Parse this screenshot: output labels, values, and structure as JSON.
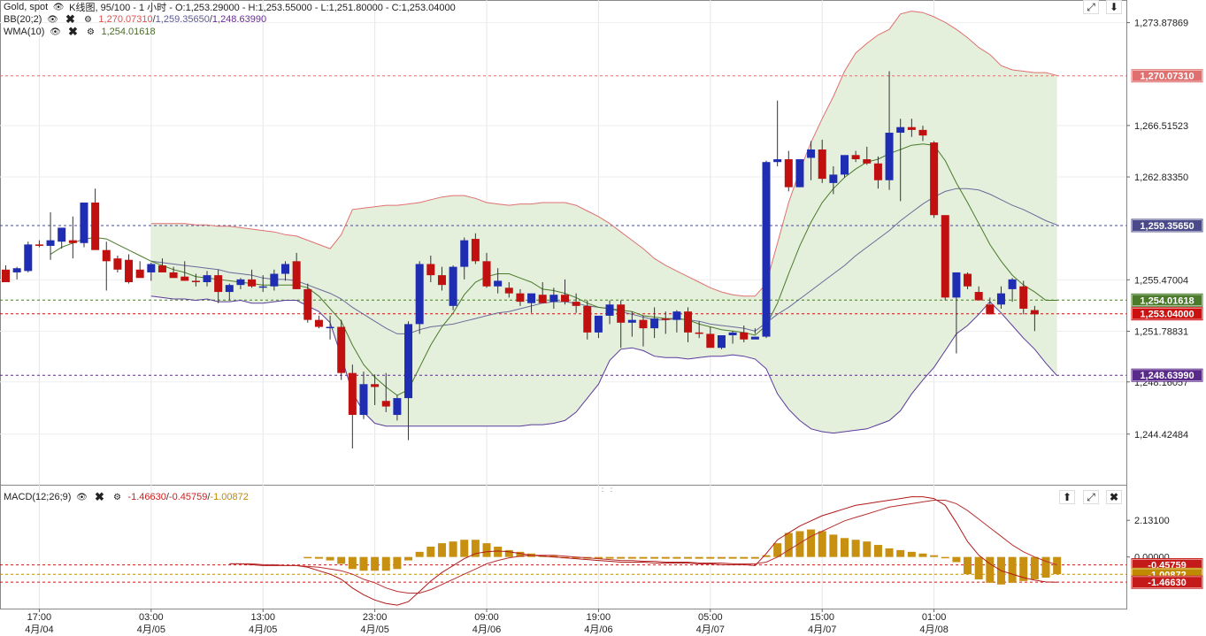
{
  "header": {
    "symbol": "Gold, spot",
    "chart_info": "K线图, 95/100 - 1 小时 - O:1,253.29000 - H:1,253.55000 - L:1,251.80000 - C:1,253.04000",
    "bb_label": "BB(20;2)",
    "bb_upper": "1,270.07310",
    "bb_mid": "1,259.35650",
    "bb_lower": "1,248.63990",
    "wma_label": "WMA(10)",
    "wma_value": "1,254.01618",
    "macd_label": "MACD(12;26;9)",
    "macd_v1": "-1.46630",
    "macd_v2": "-0.45759",
    "macd_v3": "-1.00872"
  },
  "colors": {
    "bull": "#1f2db3",
    "bear": "#c01010",
    "band_fill": "#e4f0dc",
    "bb_upper": "#e07070",
    "bb_mid": "#6a6a9a",
    "bb_lower": "#5a3a9a",
    "wma": "#4a7a2a",
    "macd_hist": "#c89010",
    "macd_line": "#b01818",
    "signal_line": "#b83030"
  },
  "icons": [
    "eye-icon",
    "close-icon",
    "gear-icon",
    "expand-icon",
    "arrow-up-icon",
    "arrow-down-icon"
  ],
  "chart_data": {
    "type": "candlestick",
    "ylim": [
      1240.8,
      1275.5
    ],
    "x_ticks": [
      {
        "time": "17:00",
        "date": "4月/04",
        "index": 3
      },
      {
        "time": "03:00",
        "date": "4月/05",
        "index": 13
      },
      {
        "time": "13:00",
        "date": "4月/05",
        "index": 23
      },
      {
        "time": "23:00",
        "date": "4月/05",
        "index": 33
      },
      {
        "time": "09:00",
        "date": "4月/06",
        "index": 43
      },
      {
        "time": "19:00",
        "date": "4月/06",
        "index": 53
      },
      {
        "time": "05:00",
        "date": "4月/07",
        "index": 63
      },
      {
        "time": "15:00",
        "date": "4月/07",
        "index": 73
      },
      {
        "time": "01:00",
        "date": "4月/08",
        "index": 83
      }
    ],
    "y_ticks": [
      "1,273.87869",
      "1,266.51523",
      "1,262.83350",
      "1,255.47004",
      "1,251.78831",
      "1,248.16057",
      "1,244.42484"
    ],
    "y_tick_values": [
      1273.87869,
      1266.51523,
      1262.8335,
      1255.47004,
      1251.78831,
      1248.16057,
      1244.42484
    ],
    "price_tags": [
      {
        "label": "1,270.07310",
        "value": 1270.0731,
        "color": "#e07070"
      },
      {
        "label": "1,259.35650",
        "value": 1259.3565,
        "color": "#4a4a8a"
      },
      {
        "label": "1,254.01618",
        "value": 1254.01618,
        "color": "#4a7a2a"
      },
      {
        "label": "1,253.04000",
        "value": 1253.04,
        "color": "#cc1010"
      },
      {
        "label": "1,248.63990",
        "value": 1248.6399,
        "color": "#5a2a8a"
      }
    ],
    "candles": [
      [
        1256.2,
        1256.5,
        1255.3,
        1255.3
      ],
      [
        1256.0,
        1256.4,
        1255.5,
        1256.3
      ],
      [
        1256.1,
        1258.2,
        1256.0,
        1258.0
      ],
      [
        1258.0,
        1258.3,
        1257.8,
        1257.9
      ],
      [
        1257.9,
        1260.3,
        1256.9,
        1258.3
      ],
      [
        1258.2,
        1259.0,
        1257.7,
        1259.2
      ],
      [
        1258.3,
        1260.0,
        1257.0,
        1258.1
      ],
      [
        1258.1,
        1259.9,
        1257.8,
        1261.0
      ],
      [
        1261.0,
        1262.0,
        1258.0,
        1257.6
      ],
      [
        1257.6,
        1258.2,
        1254.7,
        1256.8
      ],
      [
        1257.0,
        1257.2,
        1256.0,
        1256.2
      ],
      [
        1256.9,
        1257.3,
        1255.2,
        1255.3
      ],
      [
        1256.2,
        1256.8,
        1255.7,
        1255.6
      ],
      [
        1256.0,
        1256.7,
        1255.4,
        1256.6
      ],
      [
        1256.5,
        1257.0,
        1256.0,
        1256.0
      ],
      [
        1256.0,
        1256.4,
        1255.8,
        1255.6
      ],
      [
        1255.7,
        1256.8,
        1255.4,
        1255.4
      ],
      [
        1255.4,
        1255.9,
        1255.0,
        1255.3
      ],
      [
        1255.3,
        1256.1,
        1255.0,
        1255.8
      ],
      [
        1255.8,
        1256.2,
        1253.8,
        1254.6
      ],
      [
        1254.6,
        1255.2,
        1254.0,
        1255.1
      ],
      [
        1255.1,
        1255.6,
        1254.8,
        1255.5
      ],
      [
        1255.5,
        1256.2,
        1254.9,
        1255.0
      ],
      [
        1255.0,
        1255.8,
        1254.6,
        1255.0
      ],
      [
        1255.0,
        1256.2,
        1254.7,
        1255.9
      ],
      [
        1255.9,
        1256.8,
        1255.4,
        1256.6
      ],
      [
        1256.8,
        1257.4,
        1254.8,
        1254.8
      ],
      [
        1254.8,
        1255.2,
        1252.4,
        1252.6
      ],
      [
        1252.6,
        1252.9,
        1252.0,
        1252.1
      ],
      [
        1252.1,
        1252.9,
        1251.2,
        1252.1
      ],
      [
        1252.1,
        1252.6,
        1248.3,
        1248.8
      ],
      [
        1248.8,
        1249.4,
        1243.4,
        1245.8
      ],
      [
        1245.8,
        1248.9,
        1245.5,
        1248.0
      ],
      [
        1248.0,
        1248.7,
        1246.5,
        1247.8
      ],
      [
        1246.8,
        1248.8,
        1246.0,
        1246.4
      ],
      [
        1245.8,
        1247.2,
        1245.4,
        1247.0
      ],
      [
        1247.0,
        1252.5,
        1244.0,
        1252.3
      ],
      [
        1252.3,
        1256.8,
        1251.6,
        1256.6
      ],
      [
        1256.6,
        1257.2,
        1255.3,
        1255.8
      ],
      [
        1255.8,
        1256.4,
        1254.7,
        1255.1
      ],
      [
        1253.6,
        1256.5,
        1253.3,
        1256.4
      ],
      [
        1256.4,
        1258.5,
        1255.5,
        1258.3
      ],
      [
        1258.4,
        1258.8,
        1256.6,
        1256.8
      ],
      [
        1256.8,
        1257.4,
        1254.9,
        1255.0
      ],
      [
        1255.0,
        1256.3,
        1254.5,
        1255.4
      ],
      [
        1254.9,
        1255.3,
        1254.2,
        1254.5
      ],
      [
        1254.5,
        1254.8,
        1253.6,
        1253.9
      ],
      [
        1253.8,
        1254.2,
        1253.1,
        1254.5
      ],
      [
        1254.4,
        1255.3,
        1253.8,
        1253.8
      ],
      [
        1253.9,
        1254.9,
        1253.4,
        1254.4
      ],
      [
        1254.4,
        1255.5,
        1253.7,
        1253.9
      ],
      [
        1253.9,
        1254.5,
        1253.1,
        1253.6
      ],
      [
        1253.6,
        1254.0,
        1251.2,
        1251.7
      ],
      [
        1251.7,
        1252.3,
        1251.3,
        1252.9
      ],
      [
        1252.9,
        1254.0,
        1252.3,
        1253.7
      ],
      [
        1253.7,
        1254.0,
        1250.6,
        1252.4
      ],
      [
        1252.4,
        1253.2,
        1251.4,
        1252.6
      ],
      [
        1252.6,
        1252.9,
        1250.7,
        1252.0
      ],
      [
        1252.0,
        1253.5,
        1251.3,
        1252.7
      ],
      [
        1252.7,
        1253.2,
        1251.6,
        1252.6
      ],
      [
        1252.6,
        1253.3,
        1251.7,
        1253.2
      ],
      [
        1253.2,
        1253.5,
        1251.0,
        1251.7
      ],
      [
        1251.7,
        1252.5,
        1251.3,
        1251.6
      ],
      [
        1251.6,
        1252.1,
        1250.9,
        1250.6
      ],
      [
        1250.6,
        1251.3,
        1250.5,
        1251.5
      ],
      [
        1251.5,
        1251.8,
        1250.9,
        1251.7
      ],
      [
        1251.7,
        1252.2,
        1251.0,
        1251.2
      ],
      [
        1251.2,
        1252.0,
        1251.6,
        1251.4
      ],
      [
        1251.4,
        1264.0,
        1251.3,
        1263.9
      ],
      [
        1263.9,
        1268.3,
        1263.6,
        1264.1
      ],
      [
        1264.1,
        1264.7,
        1261.8,
        1262.1
      ],
      [
        1262.1,
        1263.7,
        1262.1,
        1264.1
      ],
      [
        1264.2,
        1265.4,
        1262.6,
        1264.8
      ],
      [
        1264.8,
        1265.5,
        1262.4,
        1262.7
      ],
      [
        1262.4,
        1263.6,
        1261.6,
        1263.0
      ],
      [
        1263.0,
        1264.3,
        1262.8,
        1264.4
      ],
      [
        1264.4,
        1264.7,
        1263.9,
        1264.1
      ],
      [
        1264.1,
        1265.0,
        1263.7,
        1263.8
      ],
      [
        1263.8,
        1264.3,
        1262.0,
        1262.6
      ],
      [
        1262.6,
        1270.4,
        1261.9,
        1266.0
      ],
      [
        1266.0,
        1267.0,
        1261.1,
        1266.4
      ],
      [
        1266.4,
        1267.0,
        1265.7,
        1266.2
      ],
      [
        1266.2,
        1266.5,
        1265.4,
        1265.8
      ],
      [
        1265.3,
        1265.4,
        1259.9,
        1260.1
      ],
      [
        1260.1,
        1260.1,
        1254.0,
        1254.2
      ],
      [
        1254.2,
        1256.0,
        1250.2,
        1256.0
      ],
      [
        1255.9,
        1256.0,
        1254.8,
        1255.0
      ],
      [
        1254.6,
        1255.0,
        1254.0,
        1254.0
      ],
      [
        1253.7,
        1254.2,
        1253.0,
        1253.0
      ],
      [
        1253.7,
        1255.0,
        1253.4,
        1254.5
      ],
      [
        1254.8,
        1255.6,
        1253.9,
        1255.5
      ],
      [
        1255.0,
        1255.4,
        1253.0,
        1253.4
      ],
      [
        1253.3,
        1253.6,
        1251.8,
        1253.0
      ]
    ],
    "bb_upper": [
      null,
      null,
      null,
      null,
      null,
      null,
      null,
      null,
      null,
      null,
      null,
      null,
      null,
      1259.5,
      1259.5,
      1259.5,
      1259.5,
      1259.4,
      1259.4,
      1259.3,
      1259.3,
      1259.2,
      1259.1,
      1259.0,
      1258.9,
      1258.7,
      1258.6,
      1258.3,
      1258.0,
      1257.7,
      1258.7,
      1260.5,
      1260.6,
      1260.7,
      1260.8,
      1260.8,
      1260.9,
      1261.0,
      1261.2,
      1261.4,
      1261.5,
      1261.5,
      1261.3,
      1261.0,
      1260.9,
      1260.8,
      1260.9,
      1260.9,
      1261.0,
      1261.0,
      1261.0,
      1260.8,
      1260.4,
      1260.0,
      1259.5,
      1258.9,
      1258.3,
      1257.7,
      1257.0,
      1256.5,
      1256.1,
      1255.7,
      1255.3,
      1254.9,
      1254.6,
      1254.4,
      1254.3,
      1254.3,
      1255.2,
      1258.1,
      1261.0,
      1263.3,
      1265.3,
      1267.0,
      1268.6,
      1270.4,
      1271.7,
      1272.4,
      1273.0,
      1273.4,
      1274.5,
      1274.7,
      1274.6,
      1274.3,
      1273.9,
      1273.4,
      1272.8,
      1272.1,
      1271.6,
      1270.8,
      1270.5,
      1270.4,
      1270.3,
      1270.3,
      1270.1
    ],
    "bb_mid": [
      null,
      null,
      null,
      null,
      null,
      null,
      null,
      null,
      null,
      null,
      null,
      null,
      null,
      1256.8,
      1256.7,
      1256.6,
      1256.5,
      1256.4,
      1256.3,
      1256.2,
      1256.0,
      1255.9,
      1255.8,
      1255.6,
      1255.5,
      1255.5,
      1255.4,
      1255.1,
      1254.8,
      1254.5,
      1254.1,
      1253.5,
      1253.0,
      1252.5,
      1252.0,
      1251.6,
      1251.6,
      1251.9,
      1252.1,
      1252.2,
      1252.3,
      1252.5,
      1252.7,
      1252.9,
      1253.1,
      1253.2,
      1253.4,
      1253.6,
      1253.8,
      1253.9,
      1253.9,
      1253.8,
      1253.6,
      1253.5,
      1253.4,
      1253.2,
      1253.0,
      1252.8,
      1252.6,
      1252.6,
      1252.7,
      1252.6,
      1252.5,
      1252.3,
      1252.2,
      1252.1,
      1252.0,
      1251.8,
      1252.4,
      1253.0,
      1253.5,
      1254.1,
      1254.7,
      1255.3,
      1255.9,
      1256.5,
      1257.2,
      1257.8,
      1258.4,
      1259.0,
      1259.7,
      1260.3,
      1260.9,
      1261.4,
      1261.8,
      1262.0,
      1262.0,
      1261.9,
      1261.6,
      1261.2,
      1260.8,
      1260.5,
      1260.1,
      1259.7,
      1259.4
    ],
    "bb_lower": [
      null,
      null,
      null,
      null,
      null,
      null,
      null,
      null,
      null,
      null,
      null,
      null,
      null,
      1254.3,
      1254.2,
      1254.1,
      1254.1,
      1254.0,
      1254.1,
      1253.9,
      1253.9,
      1254.0,
      1253.8,
      1253.8,
      1253.9,
      1254.0,
      1254.0,
      1253.6,
      1253.2,
      1252.4,
      1250.0,
      1247.4,
      1246.0,
      1245.2,
      1245.0,
      1245.0,
      1245.0,
      1245.0,
      1245.0,
      1245.0,
      1245.0,
      1245.0,
      1245.0,
      1245.0,
      1245.0,
      1245.0,
      1245.0,
      1245.1,
      1245.1,
      1245.2,
      1245.4,
      1246.0,
      1247.0,
      1248.0,
      1249.7,
      1250.5,
      1250.6,
      1250.4,
      1250.0,
      1249.9,
      1249.9,
      1249.8,
      1249.9,
      1250.0,
      1250.0,
      1250.1,
      1250.0,
      1249.8,
      1249.1,
      1247.3,
      1246.2,
      1245.4,
      1244.8,
      1244.6,
      1244.5,
      1244.6,
      1244.7,
      1244.8,
      1245.1,
      1245.4,
      1246.1,
      1247.3,
      1248.3,
      1249.2,
      1250.4,
      1251.6,
      1252.2,
      1253.0,
      1253.9,
      1253.1,
      1252.2,
      1251.3,
      1250.5,
      1249.5,
      1248.6
    ],
    "wma": [
      null,
      null,
      null,
      null,
      1257.3,
      1257.8,
      1258.1,
      1258.4,
      1258.5,
      1258.4,
      1258.0,
      1257.6,
      1257.2,
      1256.8,
      1256.5,
      1256.2,
      1256.0,
      1255.7,
      1255.6,
      1255.5,
      1255.4,
      1255.3,
      1255.2,
      1255.1,
      1255.1,
      1255.1,
      1255.1,
      1254.9,
      1254.3,
      1253.4,
      1252.5,
      1250.8,
      1249.4,
      1248.5,
      1247.8,
      1247.2,
      1247.6,
      1249.2,
      1250.8,
      1252.1,
      1253.1,
      1254.4,
      1255.3,
      1255.7,
      1255.9,
      1255.9,
      1255.6,
      1255.3,
      1254.8,
      1254.7,
      1254.5,
      1254.2,
      1253.8,
      1253.5,
      1253.4,
      1253.3,
      1253.2,
      1252.9,
      1252.8,
      1252.7,
      1252.7,
      1252.6,
      1252.3,
      1252.1,
      1251.9,
      1251.8,
      1251.7,
      1251.5,
      1252.2,
      1253.8,
      1255.9,
      1257.9,
      1259.6,
      1261.0,
      1262.0,
      1262.8,
      1263.4,
      1263.9,
      1264.1,
      1264.5,
      1264.8,
      1265.1,
      1265.2,
      1265.1,
      1264.0,
      1262.4,
      1261.0,
      1259.5,
      1258.0,
      1256.8,
      1255.8,
      1255.1,
      1254.6,
      1254.0,
      1254.0
    ],
    "macd_ylim": [
      -3.0,
      4.2
    ],
    "macd_y_ticks": [
      "2.13100",
      "0.00000",
      "-0.45759",
      "-1.00872",
      "-1.46630"
    ],
    "macd_y_tick_values": [
      2.131,
      0.0,
      -0.45759,
      -1.00872,
      -1.4663
    ],
    "macd_tags": [
      {
        "label": "-0.45759",
        "value": -0.45759,
        "color": "#c41a1a"
      },
      {
        "label": "-1.00872",
        "value": -1.00872,
        "color": "#c08a00"
      },
      {
        "label": "-1.46630",
        "value": -1.4663,
        "color": "#c41a1a"
      }
    ],
    "macd_hist": [
      null,
      null,
      null,
      null,
      null,
      null,
      null,
      null,
      null,
      null,
      null,
      null,
      null,
      null,
      null,
      null,
      null,
      null,
      null,
      null,
      null,
      null,
      null,
      null,
      null,
      null,
      null,
      0.0,
      -0.1,
      -0.2,
      -0.4,
      -0.7,
      -0.8,
      -0.8,
      -0.8,
      -0.7,
      -0.2,
      0.3,
      0.6,
      0.8,
      0.9,
      1.0,
      1.0,
      0.8,
      0.6,
      0.4,
      0.3,
      0.2,
      0.1,
      0.1,
      0.0,
      0.0,
      -0.1,
      -0.1,
      -0.1,
      -0.1,
      -0.1,
      -0.1,
      -0.1,
      -0.1,
      -0.1,
      -0.1,
      -0.1,
      -0.1,
      -0.1,
      -0.1,
      -0.1,
      -0.1,
      0.1,
      0.8,
      1.4,
      1.5,
      1.6,
      1.5,
      1.3,
      1.1,
      1.0,
      0.9,
      0.7,
      0.5,
      0.4,
      0.3,
      0.2,
      0.1,
      0.0,
      -0.3,
      -1.0,
      -1.3,
      -1.5,
      -1.6,
      -1.5,
      -1.4,
      -1.3,
      -1.2,
      -1.0
    ],
    "macd_line": [
      null,
      null,
      null,
      null,
      null,
      null,
      null,
      null,
      null,
      null,
      null,
      null,
      null,
      null,
      null,
      null,
      null,
      null,
      null,
      null,
      -0.4,
      -0.4,
      -0.45,
      -0.5,
      -0.5,
      -0.5,
      -0.5,
      -0.6,
      -0.8,
      -1.0,
      -1.3,
      -1.8,
      -2.2,
      -2.5,
      -2.7,
      -2.8,
      -2.6,
      -2.0,
      -1.4,
      -0.9,
      -0.5,
      -0.1,
      0.2,
      0.3,
      0.35,
      0.3,
      0.2,
      0.1,
      0.05,
      0.0,
      -0.05,
      -0.1,
      -0.15,
      -0.2,
      -0.25,
      -0.3,
      -0.3,
      -0.3,
      -0.35,
      -0.35,
      -0.35,
      -0.35,
      -0.4,
      -0.4,
      -0.45,
      -0.45,
      -0.45,
      -0.5,
      0.2,
      1.0,
      1.4,
      1.8,
      2.1,
      2.4,
      2.6,
      2.8,
      3.0,
      3.1,
      3.2,
      3.3,
      3.4,
      3.5,
      3.5,
      3.4,
      3.0,
      2.0,
      0.9,
      0.1,
      -0.4,
      -0.8,
      -1.0,
      -1.2,
      -1.35,
      -1.45,
      -1.47
    ],
    "signal_line": [
      null,
      null,
      null,
      null,
      null,
      null,
      null,
      null,
      null,
      null,
      null,
      null,
      null,
      null,
      null,
      null,
      null,
      null,
      null,
      null,
      -0.4,
      -0.4,
      -0.4,
      -0.45,
      -0.45,
      -0.5,
      -0.5,
      -0.55,
      -0.6,
      -0.7,
      -0.8,
      -1.0,
      -1.3,
      -1.5,
      -1.8,
      -2.0,
      -2.1,
      -2.1,
      -1.9,
      -1.6,
      -1.3,
      -1.0,
      -0.7,
      -0.4,
      -0.2,
      -0.05,
      0.05,
      0.1,
      0.1,
      0.1,
      0.05,
      0.0,
      -0.05,
      -0.1,
      -0.15,
      -0.2,
      -0.2,
      -0.25,
      -0.25,
      -0.3,
      -0.3,
      -0.3,
      -0.35,
      -0.35,
      -0.35,
      -0.4,
      -0.4,
      -0.4,
      -0.3,
      0.0,
      0.4,
      0.8,
      1.2,
      1.5,
      1.8,
      2.1,
      2.3,
      2.5,
      2.7,
      2.9,
      3.0,
      3.1,
      3.2,
      3.3,
      3.3,
      3.1,
      2.7,
      2.2,
      1.7,
      1.2,
      0.7,
      0.3,
      0.0,
      -0.25,
      -0.46
    ]
  }
}
